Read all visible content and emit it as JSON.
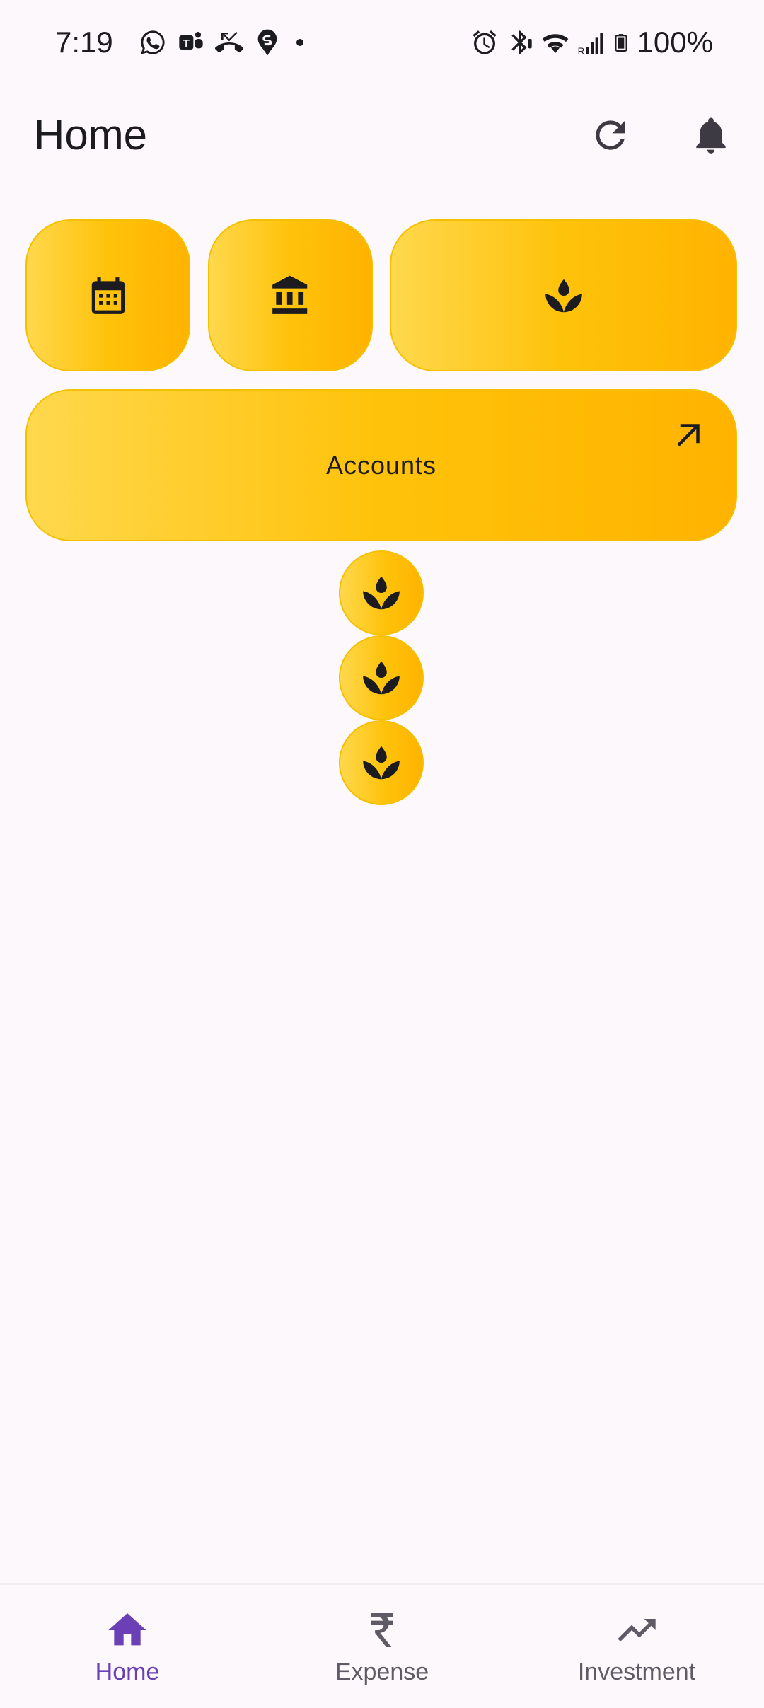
{
  "status_bar": {
    "time": "7:19",
    "battery": "100%",
    "left_icons": [
      "whatsapp-icon",
      "teams-icon",
      "missed-call-icon",
      "swiggy-icon",
      "dot-icon"
    ],
    "right_icons": [
      "alarm-icon",
      "bluetooth-icon",
      "wifi-icon",
      "signal-icon",
      "battery-icon"
    ]
  },
  "header": {
    "title": "Home",
    "actions": [
      "refresh-icon",
      "bell-icon"
    ]
  },
  "tiles": {
    "row1": [
      "calendar-icon",
      "bank-icon",
      "spa-icon"
    ],
    "accounts_label": "Accounts",
    "accounts_icon": "arrow-up-right-icon"
  },
  "circle_buttons": [
    "spa-icon",
    "spa-icon",
    "spa-icon"
  ],
  "bottom_nav": {
    "items": [
      {
        "label": "Home",
        "icon": "home-icon",
        "active": true
      },
      {
        "label": "Expense",
        "icon": "rupee-icon",
        "active": false
      },
      {
        "label": "Investment",
        "icon": "trending-up-icon",
        "active": false
      }
    ]
  },
  "colors": {
    "accent": "#6b3fb5",
    "tile": "#ffc20a",
    "background": "#fdf8fb",
    "inactive": "#5f5b66"
  }
}
